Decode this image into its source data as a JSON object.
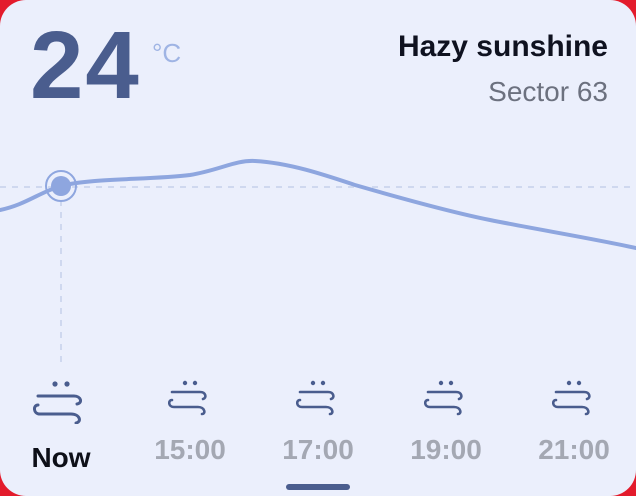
{
  "weather": {
    "temperature": "24",
    "unit": "°C",
    "condition": "Hazy sunshine",
    "location": "Sector 63"
  },
  "hourly": [
    {
      "time": "Now",
      "icon": "haze-icon",
      "selected": true
    },
    {
      "time": "15:00",
      "icon": "haze-icon",
      "selected": false
    },
    {
      "time": "17:00",
      "icon": "haze-icon",
      "selected": false
    },
    {
      "time": "19:00",
      "icon": "haze-icon",
      "selected": false
    },
    {
      "time": "21:00",
      "icon": "haze-icon",
      "selected": false
    }
  ],
  "colors": {
    "accent": "#4a5d8e",
    "curve": "#8ea6df",
    "background": "#ebeffc"
  }
}
